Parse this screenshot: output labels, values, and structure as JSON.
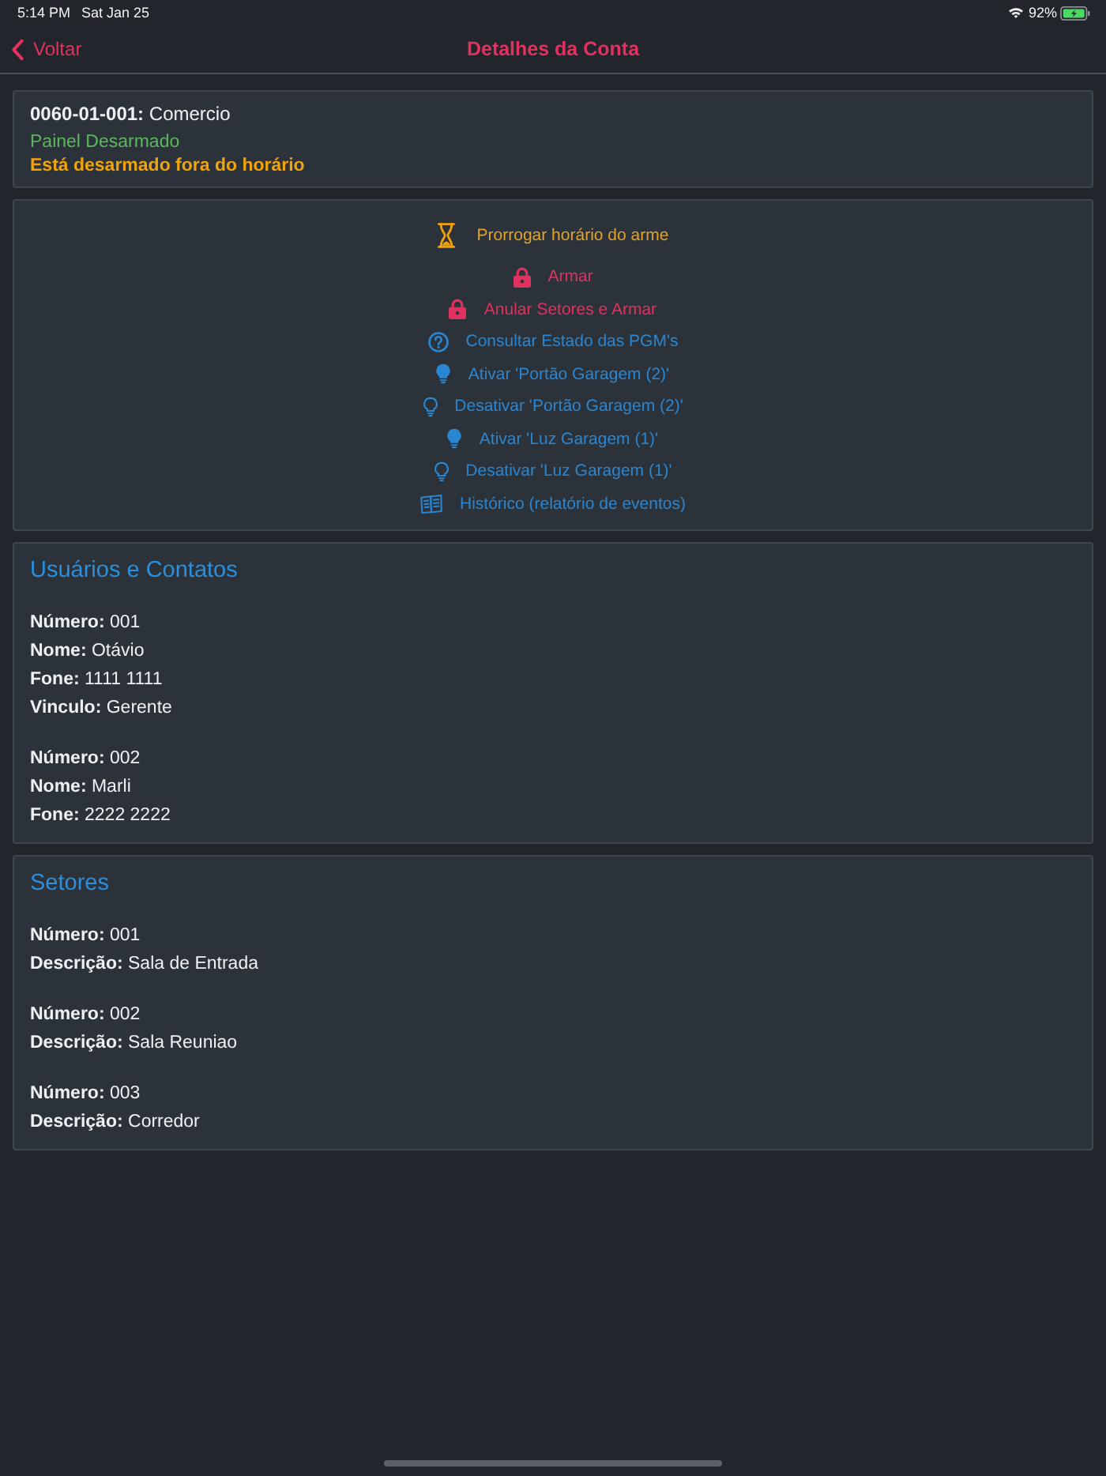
{
  "status_bar": {
    "time": "5:14 PM",
    "date": "Sat Jan 25",
    "battery": "92%"
  },
  "nav": {
    "back": "Voltar",
    "title": "Detalhes da Conta"
  },
  "account": {
    "heading": "**0060-01-001:** Comercio",
    "status_lines": [
      {
        "text": "Painel Desarmado",
        "color": "#5cb85c",
        "bold": false
      },
      {
        "text": "Está desarmado fora do horário",
        "color": "#f0a30a",
        "bold": true
      }
    ]
  },
  "actions": [
    {
      "kind": "hourglass",
      "label": "Prorrogar horário do arme",
      "color": "#e2a227"
    },
    {
      "kind": "lock",
      "label": "Armar",
      "color": "#e0315f"
    },
    {
      "kind": "lock",
      "label": "Anular Setores e Armar",
      "color": "#e0315f"
    },
    {
      "kind": "question",
      "label": "Consultar Estado das PGM's",
      "color": "#2a86d1"
    },
    {
      "kind": "bulb",
      "label": "Ativar 'Portão Garagem (2)'",
      "color": "#2a86d1"
    },
    {
      "kind": "bulboutline",
      "label": "Desativar 'Portão Garagem (2)'",
      "color": "#2a86d1"
    },
    {
      "kind": "bulb",
      "label": "Ativar 'Luz Garagem (1)'",
      "color": "#2a86d1"
    },
    {
      "kind": "bulboutline",
      "label": "Desativar 'Luz Garagem (1)'",
      "color": "#2a86d1"
    },
    {
      "kind": "book",
      "label": "Histórico (relatório de eventos)",
      "color": "#2a86d1"
    }
  ],
  "sections": [
    {
      "title": "Usuários e Contatos",
      "records": [
        {
          "lines": [
            "**Número:** 001",
            "**Nome:** Otávio",
            "**Fone:** 1111 1111",
            "**Vinculo:** Gerente"
          ]
        },
        {
          "lines": [
            "**Número:** 002",
            "**Nome:** Marli",
            "**Fone:** 2222 2222"
          ]
        }
      ]
    },
    {
      "title": "Setores",
      "records": [
        {
          "lines": [
            "**Número:** 001",
            "**Descrição:** Sala de Entrada"
          ]
        },
        {
          "lines": [
            "**Número:** 002",
            "**Descrição:** Sala Reuniao"
          ]
        },
        {
          "lines": [
            "**Número:** 003",
            "**Descrição:** Corredor"
          ]
        }
      ]
    }
  ]
}
